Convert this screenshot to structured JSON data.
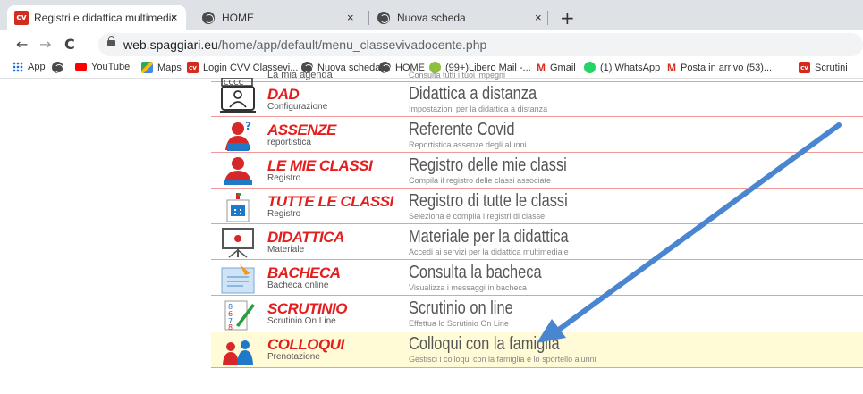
{
  "tabs": [
    {
      "title": "Registri e didattica multimediale",
      "active": true
    },
    {
      "title": "HOME",
      "active": false
    },
    {
      "title": "Nuova scheda",
      "active": false
    }
  ],
  "tab_close": "×",
  "new_tab": "+",
  "nav": {
    "back": "←",
    "forward": "→",
    "reload": "C"
  },
  "url": {
    "host": "web.spaggiari.eu",
    "path": "/home/app/default/menu_classevivadocente.php"
  },
  "bookmarks": [
    {
      "label": "App",
      "icon": "apps-grid-icon"
    },
    {
      "label": "",
      "icon": "globe-icon"
    },
    {
      "label": "YouTube",
      "icon": "youtube-icon",
      "color": "#ff0000"
    },
    {
      "label": "Maps",
      "icon": "maps-icon"
    },
    {
      "label": "Login CVV Classevi...",
      "icon": "cvv-icon",
      "color": "#d52b1e"
    },
    {
      "label": "Nuova scheda",
      "icon": "globe-icon"
    },
    {
      "label": "HOME",
      "icon": "globe-icon"
    },
    {
      "label": "(99+)Libero Mail -...",
      "icon": "libero-icon"
    },
    {
      "label": "Gmail",
      "icon": "gmail-icon"
    },
    {
      "label": "(1) WhatsApp",
      "icon": "whatsapp-icon",
      "color": "#25d366"
    },
    {
      "label": "Posta in arrivo (53)...",
      "icon": "gmail-icon"
    },
    {
      "label": "Scrutini",
      "icon": "cvv-icon",
      "color": "#d52b1e"
    }
  ],
  "menu": [
    {
      "title": "",
      "subtitle": "La mia agenda",
      "heading": "",
      "description": "Consulta tutti i tuoi impegni",
      "icon": "calendar-icon"
    },
    {
      "title": "DAD",
      "subtitle": "Configurazione",
      "heading": "Didattica a distanza",
      "description": "Impostazioni per la didattica a distanza",
      "icon": "monitor-user-icon"
    },
    {
      "title": "ASSENZE",
      "subtitle": "reportistica",
      "heading": "Referente Covid",
      "description": "Reportistica assenze degli alunni",
      "icon": "absence-user-icon"
    },
    {
      "title": "LE MIE CLASSI",
      "subtitle": "Registro",
      "heading": "Registro delle mie classi",
      "description": "Compila il registro delle classi associate",
      "icon": "teacher-icon"
    },
    {
      "title": "TUTTE LE CLASSI",
      "subtitle": "Registro",
      "heading": "Registro di tutte le classi",
      "description": "Seleziona e compila i registri di classe",
      "icon": "school-building-icon"
    },
    {
      "title": "DIDATTICA",
      "subtitle": "Materiale",
      "heading": "Materiale per la didattica",
      "description": "Accedi ai servizi per la didattica multimediale",
      "icon": "presentation-board-icon"
    },
    {
      "title": "BACHECA",
      "subtitle": "Bacheca online",
      "heading": "Consulta la bacheca",
      "description": "Visualizza i messaggi in bacheca",
      "icon": "noticeboard-icon"
    },
    {
      "title": "SCRUTINIO",
      "subtitle": "Scrutinio On Line",
      "heading": "Scrutinio on line",
      "description": "Effettua lo Scrutinio On Line",
      "icon": "grades-sheet-icon"
    },
    {
      "title": "COLLOQUI",
      "subtitle": "Prenotazione",
      "heading": "Colloqui con la famiglia",
      "description": "Gestisci i colloqui con la famiglia e lo sportello alunni",
      "icon": "parents-meeting-icon"
    }
  ],
  "colors": {
    "accent_red": "#e41d1d",
    "arrow_blue": "#4a86d0",
    "row_border": "#f29a9a",
    "highlight_row": "#fffbd6"
  }
}
